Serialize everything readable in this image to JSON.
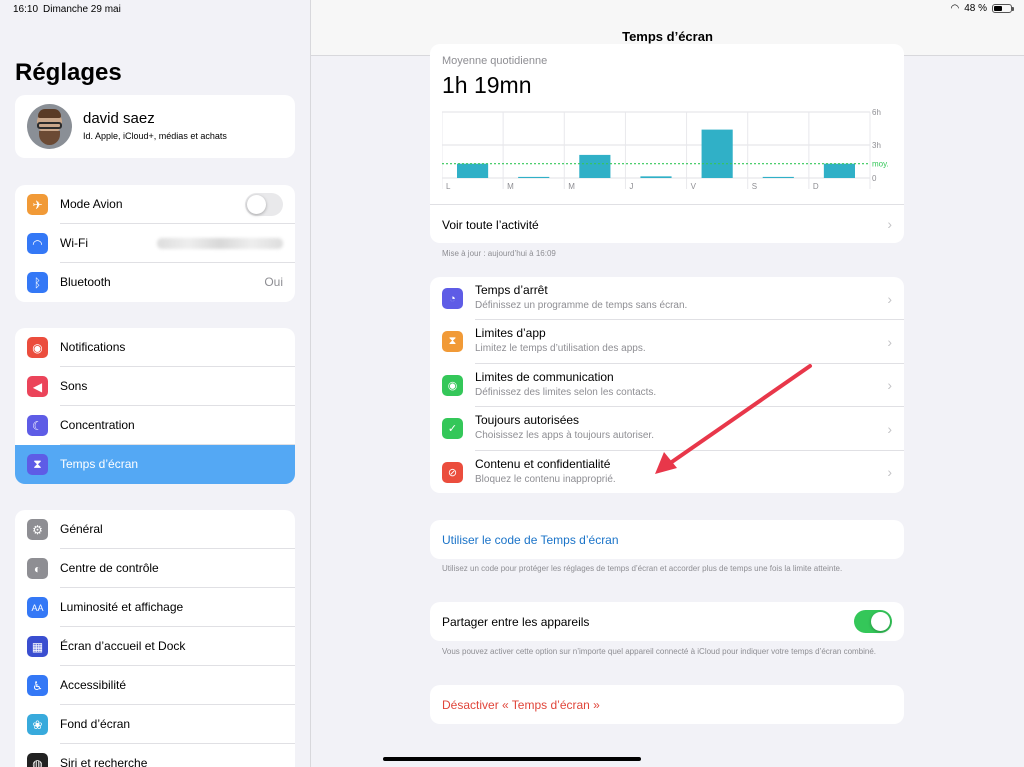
{
  "status_bar": {
    "time": "16:10",
    "date": "Dimanche 29 mai",
    "battery": "48 %"
  },
  "sidebar": {
    "title": "Réglages",
    "profile": {
      "name": "david saez",
      "subtitle": "Id. Apple, iCloud+, médias et achats"
    },
    "group1": [
      {
        "label": "Mode Avion",
        "color": "#f19a37",
        "icon": "airplane-icon",
        "glyph": "✈"
      },
      {
        "label": "Wi-Fi",
        "color": "#3478f6",
        "icon": "wifi-icon",
        "glyph": "◠"
      },
      {
        "label": "Bluetooth",
        "color": "#3478f6",
        "icon": "bluetooth-icon",
        "glyph": "ᛒ",
        "value": "Oui"
      }
    ],
    "group2": [
      {
        "label": "Notifications",
        "color": "#eb4d3d",
        "icon": "notifications-icon",
        "glyph": "◉"
      },
      {
        "label": "Sons",
        "color": "#eb445a",
        "icon": "sounds-icon",
        "glyph": "◀"
      },
      {
        "label": "Concentration",
        "color": "#5e5ce6",
        "icon": "moon-icon",
        "glyph": "☾"
      },
      {
        "label": "Temps d’écran",
        "color": "#5e5ce6",
        "icon": "hourglass-icon",
        "glyph": "⧗"
      }
    ],
    "group3": [
      {
        "label": "Général",
        "color": "#8e8e93",
        "icon": "gear-icon",
        "glyph": "⚙"
      },
      {
        "label": "Centre de contrôle",
        "color": "#8e8e93",
        "icon": "control-center-icon",
        "glyph": "◐"
      },
      {
        "label": "Luminosité et affichage",
        "color": "#3478f6",
        "icon": "brightness-icon",
        "glyph": "AA"
      },
      {
        "label": "Écran d’accueil et Dock",
        "color": "#3a4ed0",
        "icon": "home-screen-icon",
        "glyph": "▦"
      },
      {
        "label": "Accessibilité",
        "color": "#3478f6",
        "icon": "accessibility-icon",
        "glyph": "♿"
      },
      {
        "label": "Fond d’écran",
        "color": "#38aadc",
        "icon": "wallpaper-icon",
        "glyph": "❀"
      },
      {
        "label": "Siri et recherche",
        "color": "#222222",
        "icon": "siri-icon",
        "glyph": "◍"
      }
    ]
  },
  "main": {
    "title": "Temps d’écran",
    "average_label": "Moyenne quotidienne",
    "average_value": "1h 19mn",
    "see_all": "Voir toute l’activité",
    "updated": "Mise à jour : aujourd’hui à 16:09",
    "items": [
      {
        "title": "Temps d’arrêt",
        "subtitle": "Définissez un programme de temps sans écran.",
        "color": "#5e5ce6",
        "icon": "downtime-icon",
        "glyph": "◔"
      },
      {
        "title": "Limites d’app",
        "subtitle": "Limitez le temps d’utilisation des apps.",
        "color": "#f19a37",
        "icon": "hourglass-icon",
        "glyph": "⧗"
      },
      {
        "title": "Limites de communication",
        "subtitle": "Définissez des limites selon les contacts.",
        "color": "#34c759",
        "icon": "contact-icon",
        "glyph": "◉"
      },
      {
        "title": "Toujours autorisées",
        "subtitle": "Choisissez les apps à toujours autoriser.",
        "color": "#34c759",
        "icon": "checkmark-icon",
        "glyph": "✓"
      },
      {
        "title": "Contenu et confidentialité",
        "subtitle": "Bloquez le contenu inapproprié.",
        "color": "#eb4d3d",
        "icon": "restriction-icon",
        "glyph": "⊘"
      }
    ],
    "code_label": "Utiliser le code de Temps d’écran",
    "code_footer": "Utilisez un code pour protéger les réglages de temps d’écran et accorder plus de temps une fois la limite atteinte.",
    "share_label": "Partager entre les appareils",
    "share_footer": "Vous pouvez activer cette option sur n’importe quel appareil connecté à iCloud pour indiquer votre temps d’écran combiné.",
    "disable_label": "Désactiver « Temps d’écran »"
  },
  "chart_data": {
    "type": "bar",
    "categories": [
      "L",
      "M",
      "M",
      "J",
      "V",
      "S",
      "D"
    ],
    "values": [
      1.3,
      0.1,
      2.1,
      0.15,
      4.4,
      0.1,
      1.3
    ],
    "ylim": [
      0,
      6
    ],
    "ytick_labels": [
      "0",
      "3h",
      "6h"
    ],
    "average": 1.3,
    "average_label": "moy.",
    "bar_color": "#30b0c7",
    "average_color": "#34c759"
  }
}
